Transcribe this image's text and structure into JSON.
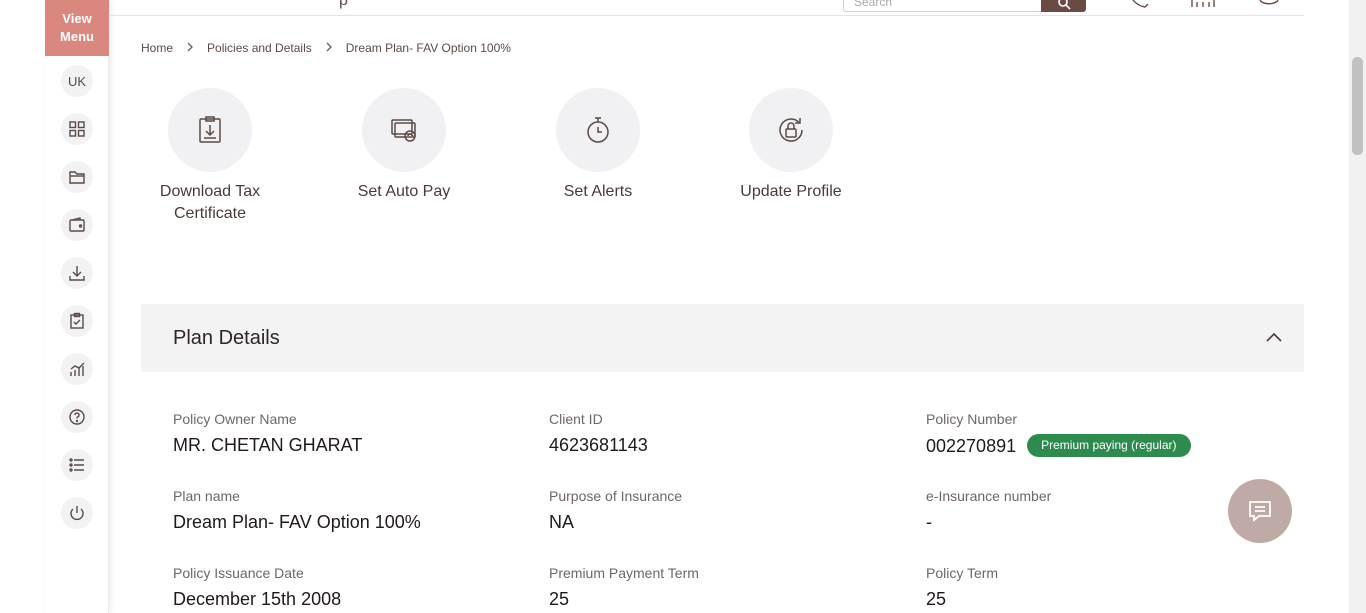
{
  "sidebar": {
    "view_menu": "View Menu",
    "avatar": "UK",
    "items": [
      {
        "icon": "dashboard-grid-icon"
      },
      {
        "icon": "folder-icon"
      },
      {
        "icon": "wallet-icon"
      },
      {
        "icon": "download-icon"
      },
      {
        "icon": "clipboard-check-icon"
      },
      {
        "icon": "growth-chart-icon"
      },
      {
        "icon": "help-icon"
      },
      {
        "icon": "list-icon"
      },
      {
        "icon": "power-icon"
      }
    ]
  },
  "header": {
    "title_fragment": "p",
    "search_placeholder": "Search"
  },
  "breadcrumb": [
    "Home",
    "Policies and Details",
    "Dream Plan- FAV Option 100%"
  ],
  "actions": [
    {
      "label": "Download Tax Certificate",
      "icon": "tax-certificate-icon"
    },
    {
      "label": "Set Auto Pay",
      "icon": "auto-pay-icon"
    },
    {
      "label": "Set Alerts",
      "icon": "alarm-icon"
    },
    {
      "label": "Update Profile",
      "icon": "update-profile-icon"
    }
  ],
  "plan": {
    "title": "Plan Details",
    "fields": {
      "owner": {
        "label": "Policy Owner Name",
        "value": "MR. CHETAN GHARAT"
      },
      "client_id": {
        "label": "Client ID",
        "value": "4623681143"
      },
      "policy_number": {
        "label": "Policy Number",
        "value": "002270891",
        "status": "Premium paying (regular)"
      },
      "plan_name": {
        "label": "Plan name",
        "value": "Dream Plan- FAV Option 100%"
      },
      "purpose": {
        "label": "Purpose of Insurance",
        "value": "NA"
      },
      "e_insurance": {
        "label": "e-Insurance number",
        "value": "-"
      },
      "issuance_date": {
        "label": "Policy Issuance Date",
        "value": "December 15th 2008"
      },
      "ppt": {
        "label": "Premium Payment Term",
        "value": "25"
      },
      "policy_term": {
        "label": "Policy Term",
        "value": "25"
      }
    }
  },
  "colors": {
    "brand": "#6b4a44",
    "menu_accent": "#d9877f",
    "status_green": "#2e8b4e",
    "chat_fab": "#bfaaa6"
  }
}
